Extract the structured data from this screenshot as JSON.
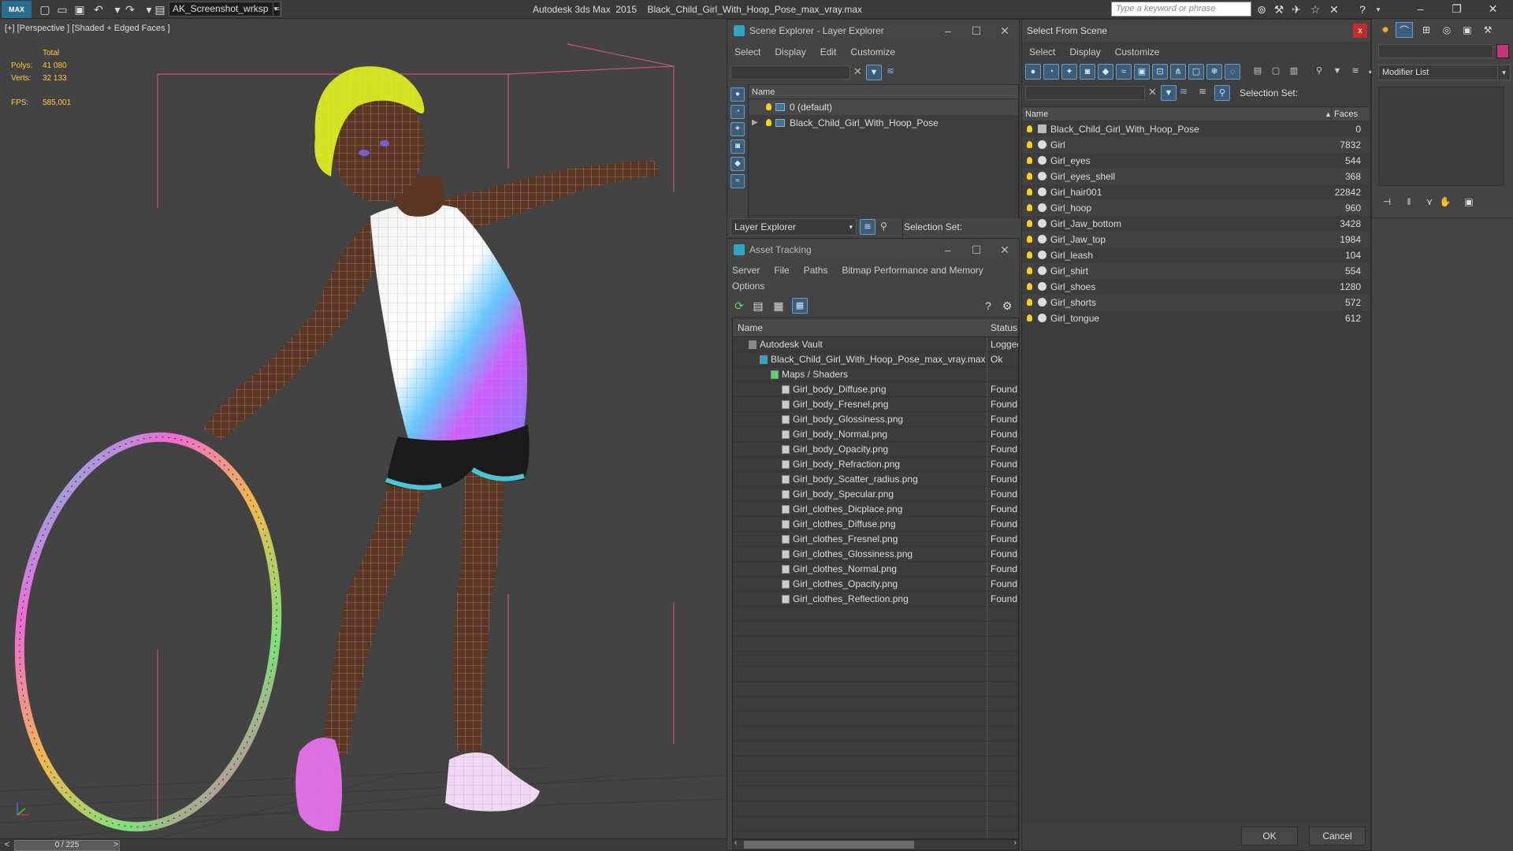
{
  "titlebar": {
    "logo": "MAX",
    "workspace": "AK_Screenshot_wrksp",
    "app_name": "Autodesk 3ds Max  2015",
    "file_name": "Black_Child_Girl_With_Hoop_Pose_max_vray.max",
    "search_placeholder": "Type a keyword or phrase"
  },
  "viewport": {
    "label": "[+] [Perspective ] [Shaded + Edged Faces ]",
    "stats": {
      "total_label": "Total",
      "polys_label": "Polys:",
      "polys_value": "41 080",
      "verts_label": "Verts:",
      "verts_value": "32 133",
      "fps_label": "FPS:",
      "fps_value": "585,001"
    }
  },
  "timeline": {
    "frame": "0 / 225",
    "prev": "<",
    "next": ">"
  },
  "scene_explorer": {
    "title": "Scene Explorer - Layer Explorer",
    "menu": [
      "Select",
      "Display",
      "Edit",
      "Customize"
    ],
    "column_name": "Name",
    "layers": [
      {
        "name": "0 (default)"
      },
      {
        "name": "Black_Child_Girl_With_Hoop_Pose"
      }
    ],
    "bottom_select": "Layer Explorer",
    "selection_set_label": "Selection Set:"
  },
  "asset_tracking": {
    "title": "Asset Tracking",
    "menu_row1": [
      "Server",
      "File",
      "Paths",
      "Bitmap Performance and Memory"
    ],
    "menu_row2": [
      "Options"
    ],
    "col_name": "Name",
    "col_status": "Status",
    "rows": [
      {
        "name": "Autodesk Vault",
        "status": "Logged"
      },
      {
        "name": "Black_Child_Girl_With_Hoop_Pose_max_vray.max",
        "status": "Ok"
      },
      {
        "name": "Maps / Shaders",
        "status": ""
      },
      {
        "name": "Girl_body_Diffuse.png",
        "status": "Found"
      },
      {
        "name": "Girl_body_Fresnel.png",
        "status": "Found"
      },
      {
        "name": "Girl_body_Glossiness.png",
        "status": "Found"
      },
      {
        "name": "Girl_body_Normal.png",
        "status": "Found"
      },
      {
        "name": "Girl_body_Opacity.png",
        "status": "Found"
      },
      {
        "name": "Girl_body_Refraction.png",
        "status": "Found"
      },
      {
        "name": "Girl_body_Scatter_radius.png",
        "status": "Found"
      },
      {
        "name": "Girl_body_Specular.png",
        "status": "Found"
      },
      {
        "name": "Girl_clothes_Dicplace.png",
        "status": "Found"
      },
      {
        "name": "Girl_clothes_Diffuse.png",
        "status": "Found"
      },
      {
        "name": "Girl_clothes_Fresnel.png",
        "status": "Found"
      },
      {
        "name": "Girl_clothes_Glossiness.png",
        "status": "Found"
      },
      {
        "name": "Girl_clothes_Normal.png",
        "status": "Found"
      },
      {
        "name": "Girl_clothes_Opacity.png",
        "status": "Found"
      },
      {
        "name": "Girl_clothes_Reflection.png",
        "status": "Found"
      }
    ]
  },
  "select_from_scene": {
    "title": "Select From Scene",
    "close": "x",
    "menu": [
      "Select",
      "Display",
      "Customize"
    ],
    "selection_set_label": "Selection Set:",
    "col_name": "Name",
    "col_faces": "Faces",
    "objects": [
      {
        "name": "Black_Child_Girl_With_Hoop_Pose",
        "faces": "0"
      },
      {
        "name": "Girl",
        "faces": "7832"
      },
      {
        "name": "Girl_eyes",
        "faces": "544"
      },
      {
        "name": "Girl_eyes_shell",
        "faces": "368"
      },
      {
        "name": "Girl_hair001",
        "faces": "22842"
      },
      {
        "name": "Girl_hoop",
        "faces": "960"
      },
      {
        "name": "Girl_Jaw_bottom",
        "faces": "3428"
      },
      {
        "name": "Girl_Jaw_top",
        "faces": "1984"
      },
      {
        "name": "Girl_leash",
        "faces": "104"
      },
      {
        "name": "Girl_shirt",
        "faces": "554"
      },
      {
        "name": "Girl_shoes",
        "faces": "1280"
      },
      {
        "name": "Girl_shorts",
        "faces": "572"
      },
      {
        "name": "Girl_tongue",
        "faces": "612"
      }
    ],
    "ok_label": "OK",
    "cancel_label": "Cancel"
  },
  "command_panel": {
    "modifier_list": "Modifier List"
  }
}
